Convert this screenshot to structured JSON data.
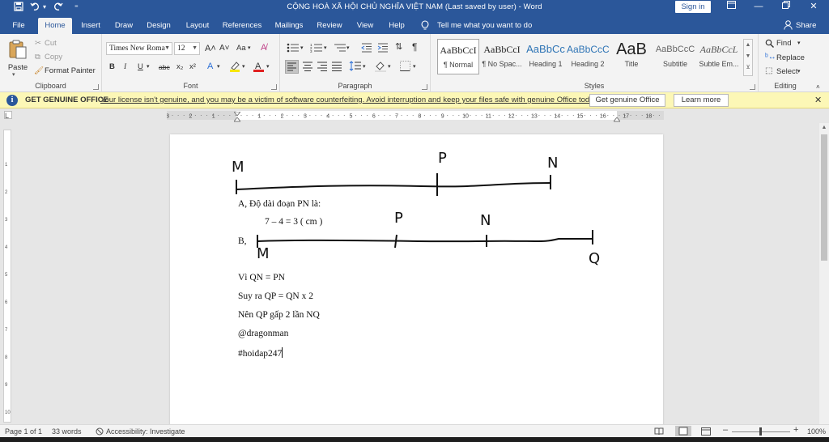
{
  "titlebar": {
    "title": "CỘNG HOÀ XÃ HỘI CHỦ NGHĨA VIỆT NAM (Last saved by user) - Word",
    "signin": "Sign in",
    "save_icon": "save-icon",
    "undo_icon": "undo-icon",
    "redo_icon": "redo-icon"
  },
  "tabs": {
    "file": "File",
    "home": "Home",
    "insert": "Insert",
    "draw": "Draw",
    "design": "Design",
    "layout": "Layout",
    "references": "References",
    "mailings": "Mailings",
    "review": "Review",
    "view": "View",
    "help": "Help",
    "tellme": "Tell me what you want to do",
    "share": "Share"
  },
  "clipboard": {
    "paste": "Paste",
    "cut": "Cut",
    "copy": "Copy",
    "format_painter": "Format Painter",
    "label": "Clipboard"
  },
  "font": {
    "name": "Times New Roma",
    "size": "12",
    "label": "Font",
    "bold": "B",
    "italic": "I",
    "underline": "U",
    "strike": "abc",
    "subscript": "x₂",
    "superscript": "x²",
    "case": "Aa"
  },
  "paragraph": {
    "label": "Paragraph"
  },
  "styles": {
    "label": "Styles",
    "items": [
      {
        "preview": "AaBbCcI",
        "name": "¶ Normal"
      },
      {
        "preview": "AaBbCcI",
        "name": "¶ No Spac..."
      },
      {
        "preview": "AaBbCc",
        "name": "Heading 1"
      },
      {
        "preview": "AaBbCcC",
        "name": "Heading 2"
      },
      {
        "preview": "AaB",
        "name": "Title"
      },
      {
        "preview": "AaBbCcC",
        "name": "Subtitle"
      },
      {
        "preview": "AaBbCcL",
        "name": "Subtle Em..."
      }
    ]
  },
  "editing": {
    "find": "Find",
    "replace": "Replace",
    "select": "Select",
    "label": "Editing"
  },
  "notice": {
    "title": "GET GENUINE OFFICE",
    "message": "Your license isn't genuine, and you may be a victim of software counterfeiting. Avoid interruption and keep your files safe with genuine Office today.",
    "get_button": "Get genuine Office",
    "learn_button": "Learn more"
  },
  "ruler": {
    "numbers": [
      "3",
      "2",
      "1",
      "1",
      "2",
      "3",
      "4",
      "5",
      "6",
      "7",
      "8",
      "9",
      "10",
      "11",
      "12",
      "13",
      "14",
      "15",
      "16",
      "17",
      "18"
    ]
  },
  "document": {
    "label_m1": "M",
    "label_p1": "P",
    "label_n1": "N",
    "line_a": "A, Độ dài đoạn PN là:",
    "line_calc": "7 – 4 = 3 ( cm )",
    "line_b": "B,",
    "label_p2": "P",
    "label_n2": "N",
    "label_m2": "M",
    "label_q2": "Q",
    "line_1": "Vì QN = PN",
    "line_2": "Suy ra QP = QN x 2",
    "line_3": "Nên QP gấp 2 lần NQ",
    "line_4": "@dragonman",
    "line_5": "#hoidap247"
  },
  "status": {
    "page": "Page 1 of 1",
    "words": "33 words",
    "accessibility": "Accessibility: Investigate",
    "zoom": "100%"
  }
}
